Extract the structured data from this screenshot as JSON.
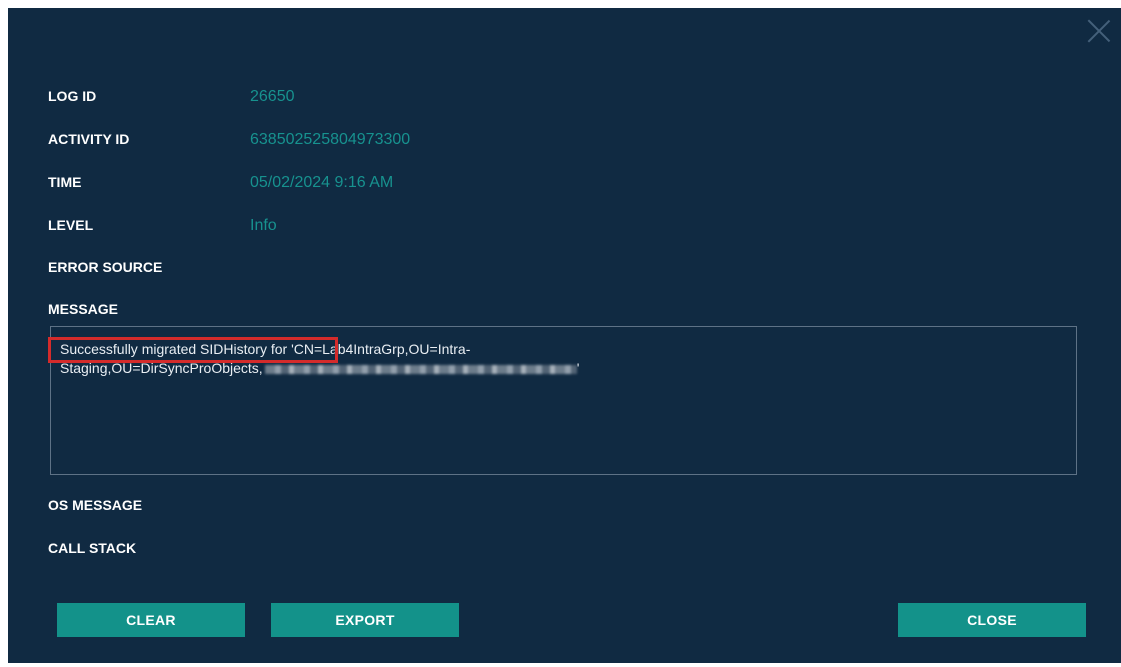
{
  "dialog": {
    "fields": [
      {
        "label": "LOG ID",
        "value": "26650"
      },
      {
        "label": "ACTIVITY ID",
        "value": "638502525804973300"
      },
      {
        "label": "TIME",
        "value": "05/02/2024 9:16 AM"
      },
      {
        "label": "LEVEL",
        "value": "Info"
      },
      {
        "label": "ERROR SOURCE",
        "value": ""
      }
    ],
    "message_label": "MESSAGE",
    "message_line1": "Successfully migrated SIDHistory for 'CN=Lab4IntraGrp,OU=Intra-",
    "message_line2": "Staging,OU=DirSyncProObjects,",
    "message_line2_end": "'",
    "os_message_label": "OS MESSAGE",
    "call_stack_label": "CALL STACK",
    "buttons": {
      "clear": "CLEAR",
      "export": "EXPORT",
      "close": "CLOSE"
    }
  },
  "colors": {
    "background": "#102a42",
    "value_text": "#17928f",
    "button": "#13928a",
    "highlight_box": "#d42b2b"
  },
  "icons": {
    "close": "close-icon"
  }
}
